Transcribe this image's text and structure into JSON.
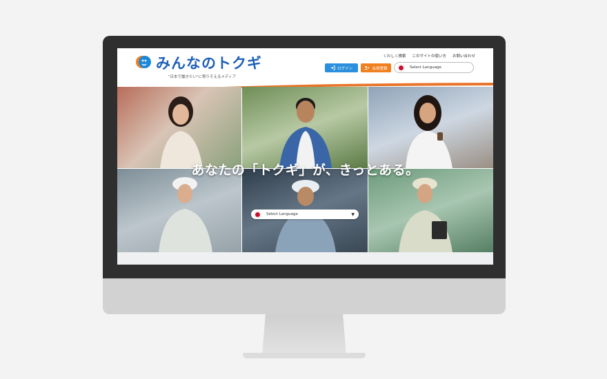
{
  "header": {
    "logo_text": "みんなのトクギ",
    "tagline": "\"日本で働きたい\"に寄りそえるメディア",
    "links": [
      "くわしく検索",
      "このサイトの使い方",
      "お問い合わせ"
    ],
    "login_label": "ログイン",
    "register_label": "会員登録",
    "language_select": "Select Language"
  },
  "hero": {
    "headline": "あなたの「トクギ」が、きっとある。",
    "language_select": "Select Language"
  },
  "colors": {
    "brand_blue": "#1e5fb8",
    "login_blue": "#2a8fdc",
    "register_orange": "#f07f1e",
    "swoosh_orange": "#e8742a",
    "flag_red": "#c8102e"
  },
  "icons": [
    "login-icon",
    "user-add-icon",
    "japan-flag-icon",
    "dropdown-caret-icon"
  ]
}
